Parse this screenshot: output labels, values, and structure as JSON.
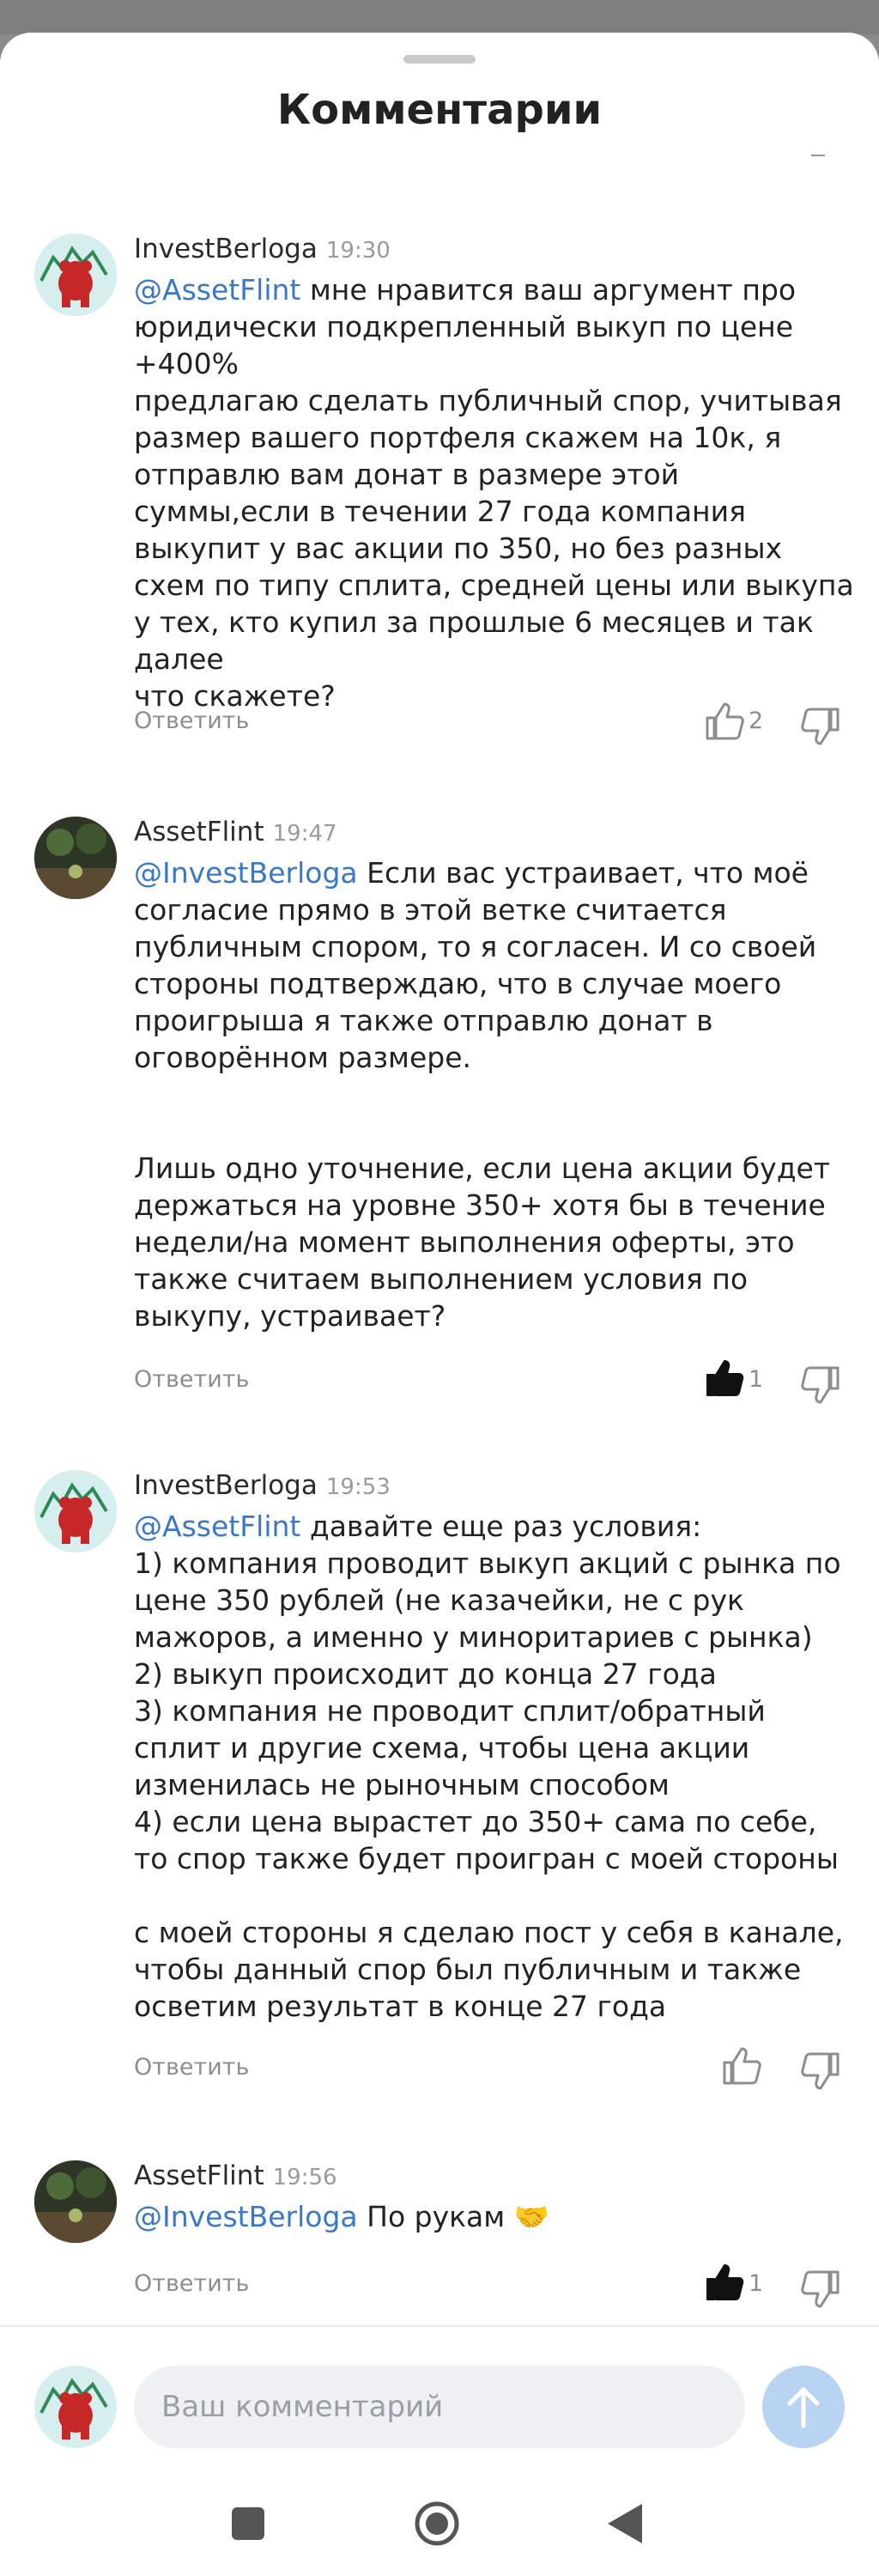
{
  "sheet": {
    "title": "Комментарии"
  },
  "comments": [
    {
      "author": "InvestBerloga",
      "time": "19:30",
      "mention": "@AssetFlint",
      "paragraphs": [
        "мне нравится ваш аргумент про юридически подкрепленный выкуп по цене +400%",
        "предлагаю сделать публичный спор, учитывая размер вашего портфеля скажем на 10к, я отправлю вам донат в размере этой суммы,если в течении 27 года компания выкупит у вас акции по 350, но без разных схем по типу сплита, средней цены или выкупа у тех, кто купил за прошлые 6 месяцев и так далее",
        "что скажете?"
      ],
      "reply_label": "Ответить",
      "likes": "2",
      "liked": false
    },
    {
      "author": "AssetFlint",
      "time": "19:47",
      "mention": "@InvestBerloga",
      "paragraphs": [
        "Если вас устраивает, что моё согласие прямо в этой ветке считается публичным спором, то я согласен. И со своей стороны подтверждаю, что в случае моего проигрыша я также отправлю донат в оговорённом размере.",
        "",
        "",
        "Лишь одно уточнение, если цена акции будет держаться на уровне 350+ хотя бы в течение недели/на момент выполнения оферты, это также считаем выполнением условия по выкупу, устраивает?"
      ],
      "reply_label": "Ответить",
      "likes": "1",
      "liked": true
    },
    {
      "author": "InvestBerloga",
      "time": "19:53",
      "mention": "@AssetFlint",
      "paragraphs": [
        "давайте еще раз условия:",
        "1) компания проводит выкуп акций с рынка по цене 350 рублей (не казачейки, не с рук мажоров, а именно у миноритариев с рынка)",
        "2) выкуп происходит до конца 27 года",
        "3) компания не проводит сплит/обратный сплит и другие схема, чтобы цена акции изменилась не рыночным способом",
        "4) если цена вырастет до 350+ сама по себе, то спор также будет проигран с моей стороны",
        "",
        "с моей стороны я сделаю пост у себя в канале, чтобы данный спор был публичным и также осветим результат в конце 27 года"
      ],
      "reply_label": "Ответить",
      "likes": "",
      "liked": false
    },
    {
      "author": "AssetFlint",
      "time": "19:56",
      "mention": "@InvestBerloga",
      "paragraphs": [
        "По рукам 🤝"
      ],
      "reply_label": "Ответить",
      "likes": "1",
      "liked": true
    }
  ],
  "composer": {
    "placeholder": "Ваш комментарий"
  },
  "colors": {
    "link": "#3a78c6",
    "send_button": "#b9d3f2",
    "input_bg": "#eef0f3"
  }
}
